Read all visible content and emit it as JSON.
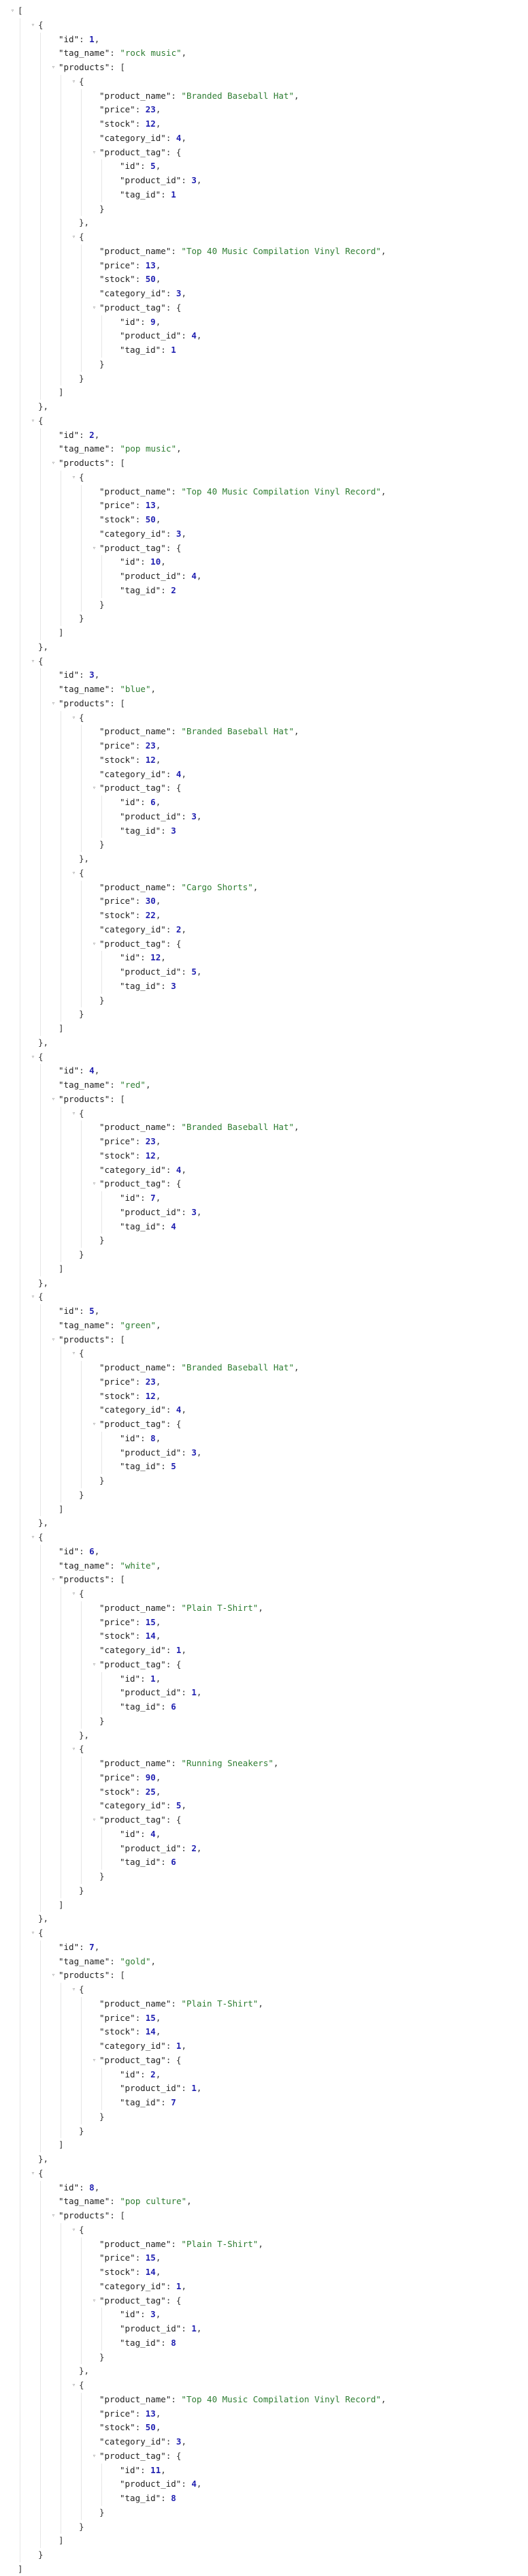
{
  "viewer": {
    "toggle_icon_glyph": "▿",
    "colors": {
      "string": "#2e7d32",
      "number": "#1f1fb0",
      "key": "#222222",
      "guide": "#e6e6e6",
      "toggle": "#9a9a9a"
    }
  },
  "tags": [
    {
      "id": 1,
      "tag_name": "rock music",
      "products": [
        {
          "product_name": "Branded Baseball Hat",
          "price": 23,
          "stock": 12,
          "category_id": 4,
          "product_tag": {
            "id": 5,
            "product_id": 3,
            "tag_id": 1
          }
        },
        {
          "product_name": "Top 40 Music Compilation Vinyl Record",
          "price": 13,
          "stock": 50,
          "category_id": 3,
          "product_tag": {
            "id": 9,
            "product_id": 4,
            "tag_id": 1
          }
        }
      ]
    },
    {
      "id": 2,
      "tag_name": "pop music",
      "products": [
        {
          "product_name": "Top 40 Music Compilation Vinyl Record",
          "price": 13,
          "stock": 50,
          "category_id": 3,
          "product_tag": {
            "id": 10,
            "product_id": 4,
            "tag_id": 2
          }
        }
      ]
    },
    {
      "id": 3,
      "tag_name": "blue",
      "products": [
        {
          "product_name": "Branded Baseball Hat",
          "price": 23,
          "stock": 12,
          "category_id": 4,
          "product_tag": {
            "id": 6,
            "product_id": 3,
            "tag_id": 3
          }
        },
        {
          "product_name": "Cargo Shorts",
          "price": 30,
          "stock": 22,
          "category_id": 2,
          "product_tag": {
            "id": 12,
            "product_id": 5,
            "tag_id": 3
          }
        }
      ]
    },
    {
      "id": 4,
      "tag_name": "red",
      "products": [
        {
          "product_name": "Branded Baseball Hat",
          "price": 23,
          "stock": 12,
          "category_id": 4,
          "product_tag": {
            "id": 7,
            "product_id": 3,
            "tag_id": 4
          }
        }
      ]
    },
    {
      "id": 5,
      "tag_name": "green",
      "products": [
        {
          "product_name": "Branded Baseball Hat",
          "price": 23,
          "stock": 12,
          "category_id": 4,
          "product_tag": {
            "id": 8,
            "product_id": 3,
            "tag_id": 5
          }
        }
      ]
    },
    {
      "id": 6,
      "tag_name": "white",
      "products": [
        {
          "product_name": "Plain T-Shirt",
          "price": 15,
          "stock": 14,
          "category_id": 1,
          "product_tag": {
            "id": 1,
            "product_id": 1,
            "tag_id": 6
          }
        },
        {
          "product_name": "Running Sneakers",
          "price": 90,
          "stock": 25,
          "category_id": 5,
          "product_tag": {
            "id": 4,
            "product_id": 2,
            "tag_id": 6
          }
        }
      ]
    },
    {
      "id": 7,
      "tag_name": "gold",
      "products": [
        {
          "product_name": "Plain T-Shirt",
          "price": 15,
          "stock": 14,
          "category_id": 1,
          "product_tag": {
            "id": 2,
            "product_id": 1,
            "tag_id": 7
          }
        }
      ]
    },
    {
      "id": 8,
      "tag_name": "pop culture",
      "products": [
        {
          "product_name": "Plain T-Shirt",
          "price": 15,
          "stock": 14,
          "category_id": 1,
          "product_tag": {
            "id": 3,
            "product_id": 1,
            "tag_id": 8
          }
        },
        {
          "product_name": "Top 40 Music Compilation Vinyl Record",
          "price": 13,
          "stock": 50,
          "category_id": 3,
          "product_tag": {
            "id": 11,
            "product_id": 4,
            "tag_id": 8
          }
        }
      ]
    }
  ]
}
